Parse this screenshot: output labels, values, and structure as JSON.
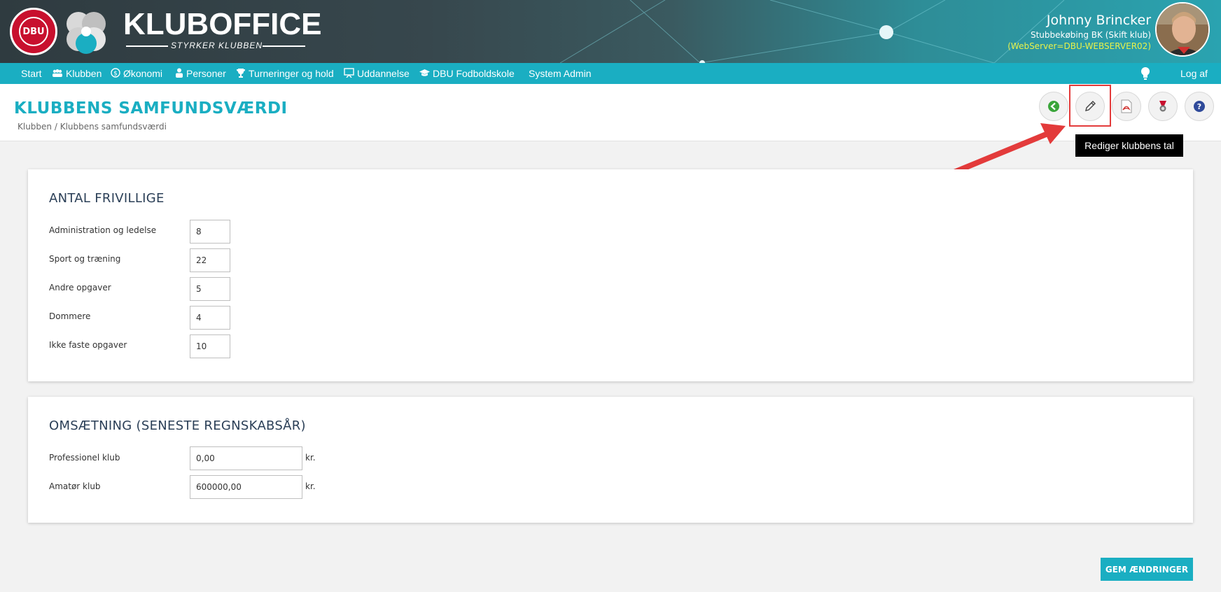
{
  "header": {
    "brand_title": "KLUBOFFICE",
    "brand_subtitle": "STYRKER KLUBBEN",
    "dbu_logo_text": "DBU",
    "user_name": "Johnny Brincker",
    "user_club": "Stubbekøbing BK (Skift klub)",
    "webserver": "(WebServer=DBU-WEBSERVER02)"
  },
  "nav": {
    "items": [
      {
        "label": "Start",
        "icon": ""
      },
      {
        "label": "Klubben",
        "icon": "people-icon"
      },
      {
        "label": "Økonomi",
        "icon": "coin-icon"
      },
      {
        "label": "Personer",
        "icon": "person-icon"
      },
      {
        "label": "Turneringer og hold",
        "icon": "trophy-icon"
      },
      {
        "label": "Uddannelse",
        "icon": "presentation-icon"
      },
      {
        "label": "DBU Fodboldskole",
        "icon": "graduation-cap-icon"
      },
      {
        "label": "System Admin",
        "icon": ""
      }
    ],
    "logout": "Log af"
  },
  "page": {
    "title": "KLUBBENS SAMFUNDSVÆRDI",
    "breadcrumb": "Klubben / Klubbens samfundsværdi",
    "tooltip": "Rediger klubbens tal"
  },
  "volunteers": {
    "title": "ANTAL FRIVILLIGE",
    "rows": [
      {
        "label": "Administration og ledelse",
        "value": "8"
      },
      {
        "label": "Sport og træning",
        "value": "22"
      },
      {
        "label": "Andre opgaver",
        "value": "5"
      },
      {
        "label": "Dommere",
        "value": "4"
      },
      {
        "label": "Ikke faste opgaver",
        "value": "10"
      }
    ]
  },
  "revenue": {
    "title": "OMSÆTNING (SENESTE REGNSKABSÅR)",
    "rows": [
      {
        "label": "Professionel klub",
        "value": "0,00",
        "unit": "kr."
      },
      {
        "label": "Amatør klub",
        "value": "600000,00",
        "unit": "kr."
      }
    ]
  },
  "save_label": "GEM ÆNDRINGER",
  "colors": {
    "accent": "#1aaec2",
    "title_dark": "#2b3f57",
    "highlight": "#e33b3b",
    "server_text": "#e8f24a"
  }
}
